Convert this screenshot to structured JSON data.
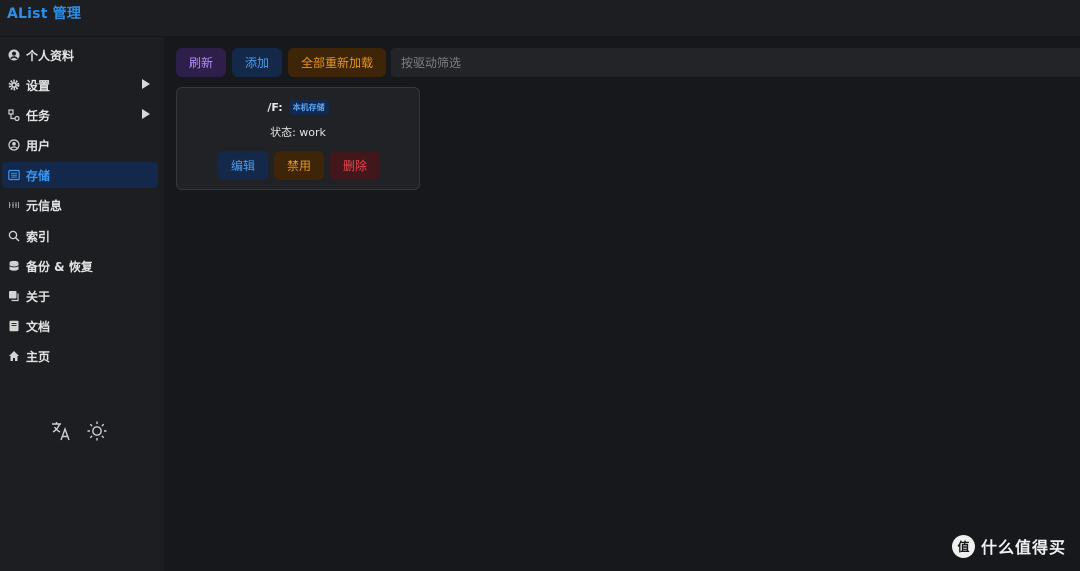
{
  "app": {
    "title": "AList 管理"
  },
  "sidebar": {
    "items": [
      {
        "label": "个人资料",
        "icon": "user-circle-icon",
        "active": false,
        "has_submenu": false
      },
      {
        "label": "设置",
        "icon": "gear-icon",
        "active": false,
        "has_submenu": true
      },
      {
        "label": "任务",
        "icon": "tasks-icon",
        "active": false,
        "has_submenu": true
      },
      {
        "label": "用户",
        "icon": "user-icon",
        "active": false,
        "has_submenu": false
      },
      {
        "label": "存储",
        "icon": "storage-icon",
        "active": true,
        "has_submenu": false
      },
      {
        "label": "元信息",
        "icon": "meta-icon",
        "active": false,
        "has_submenu": false
      },
      {
        "label": "索引",
        "icon": "search-icon",
        "active": false,
        "has_submenu": false
      },
      {
        "label": "备份 & 恢复",
        "icon": "database-icon",
        "active": false,
        "has_submenu": false
      },
      {
        "label": "关于",
        "icon": "copy-icon",
        "active": false,
        "has_submenu": false
      },
      {
        "label": "文档",
        "icon": "book-icon",
        "active": false,
        "has_submenu": false
      },
      {
        "label": "主页",
        "icon": "home-icon",
        "active": false,
        "has_submenu": false
      }
    ],
    "tools": {
      "language_icon": "translate-icon",
      "theme_icon": "sun-icon"
    }
  },
  "toolbar": {
    "refresh_label": "刷新",
    "add_label": "添加",
    "reload_all_label": "全部重新加载",
    "filter_placeholder": "按驱动筛选"
  },
  "storage_card": {
    "mount_path": "/F:",
    "driver": "本机存储",
    "status_text": "状态: work",
    "edit_label": "编辑",
    "disable_label": "禁用",
    "delete_label": "删除"
  },
  "watermark": {
    "logo_text": "值",
    "text": "什么值得买"
  },
  "colors": {
    "accent": "#2b8fe8",
    "background": "#17181b",
    "sidebar": "#1c1e21",
    "purple": "#b28bff",
    "orange": "#e59323",
    "red": "#e5484d"
  }
}
